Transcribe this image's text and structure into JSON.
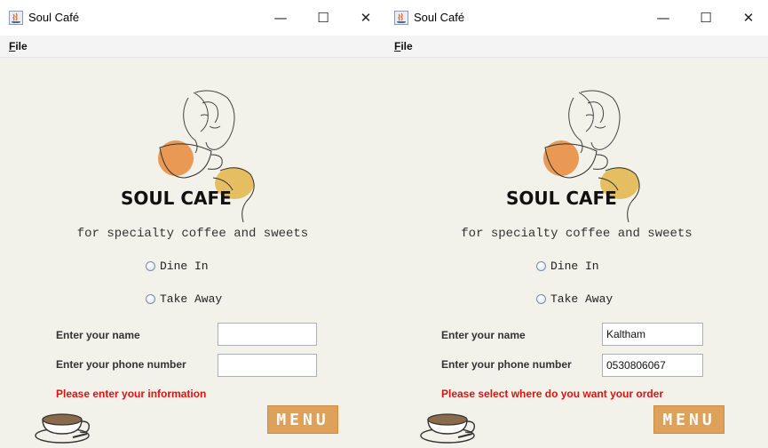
{
  "windows": [
    {
      "title": "Soul Café",
      "menu": {
        "file_mnemonic": "F",
        "file_rest": "ile"
      },
      "logo_text": "SOUL CAFE",
      "tagline": "for specialty coffee and sweets",
      "options": {
        "dine_in": "Dine In",
        "take_away": "Take Away"
      },
      "form": {
        "name_label": "Enter your name",
        "name_value": "",
        "phone_label": "Enter your phone number",
        "phone_value": ""
      },
      "error": "Please enter your information",
      "menu_button": "MENU"
    },
    {
      "title": "Soul Café",
      "menu": {
        "file_mnemonic": "F",
        "file_rest": "ile"
      },
      "logo_text": "SOUL CAFE",
      "tagline": "for specialty coffee and sweets",
      "options": {
        "dine_in": "Dine In",
        "take_away": "Take Away"
      },
      "form": {
        "name_label": "Enter your name",
        "name_value": "Kaltham",
        "phone_label": "Enter your phone number",
        "phone_value": "0530806067"
      },
      "error": "Please select where do you want your order",
      "menu_button": "MENU"
    }
  ],
  "icons": {
    "app": "java-app-icon",
    "minimize": "minimize-icon",
    "maximize": "maximize-icon",
    "close": "close-icon"
  },
  "colors": {
    "window_bg": "#f2f1ea",
    "error": "#e01010",
    "menu_button": "#dea15a",
    "logo_orange": "#e8893a",
    "logo_yellow": "#e3b54a"
  }
}
